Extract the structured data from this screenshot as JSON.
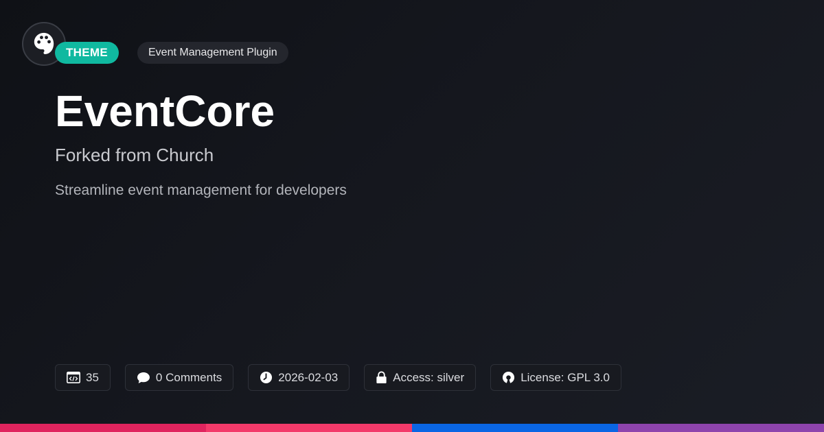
{
  "badges": {
    "type_label": "THEME",
    "category_label": "Event Management Plugin"
  },
  "logo": {
    "icon": "palette-icon"
  },
  "header": {
    "title": "EventCore",
    "subtitle": "Forked from Church",
    "description": "Streamline event management for developers"
  },
  "meta": {
    "code": {
      "icon": "code-icon",
      "value": "35"
    },
    "comments": {
      "icon": "comment-icon",
      "value": "0 Comments"
    },
    "date": {
      "icon": "clock-icon",
      "value": "2026-02-03"
    },
    "access": {
      "icon": "lock-icon",
      "value": "Access: silver"
    },
    "license": {
      "icon": "open-source-icon",
      "value": "License: GPL 3.0"
    }
  },
  "colors": {
    "accent": "#10b9a0",
    "bar": [
      "#e0245e",
      "#f33a6a",
      "#0a66e4",
      "#8e44ad"
    ]
  }
}
